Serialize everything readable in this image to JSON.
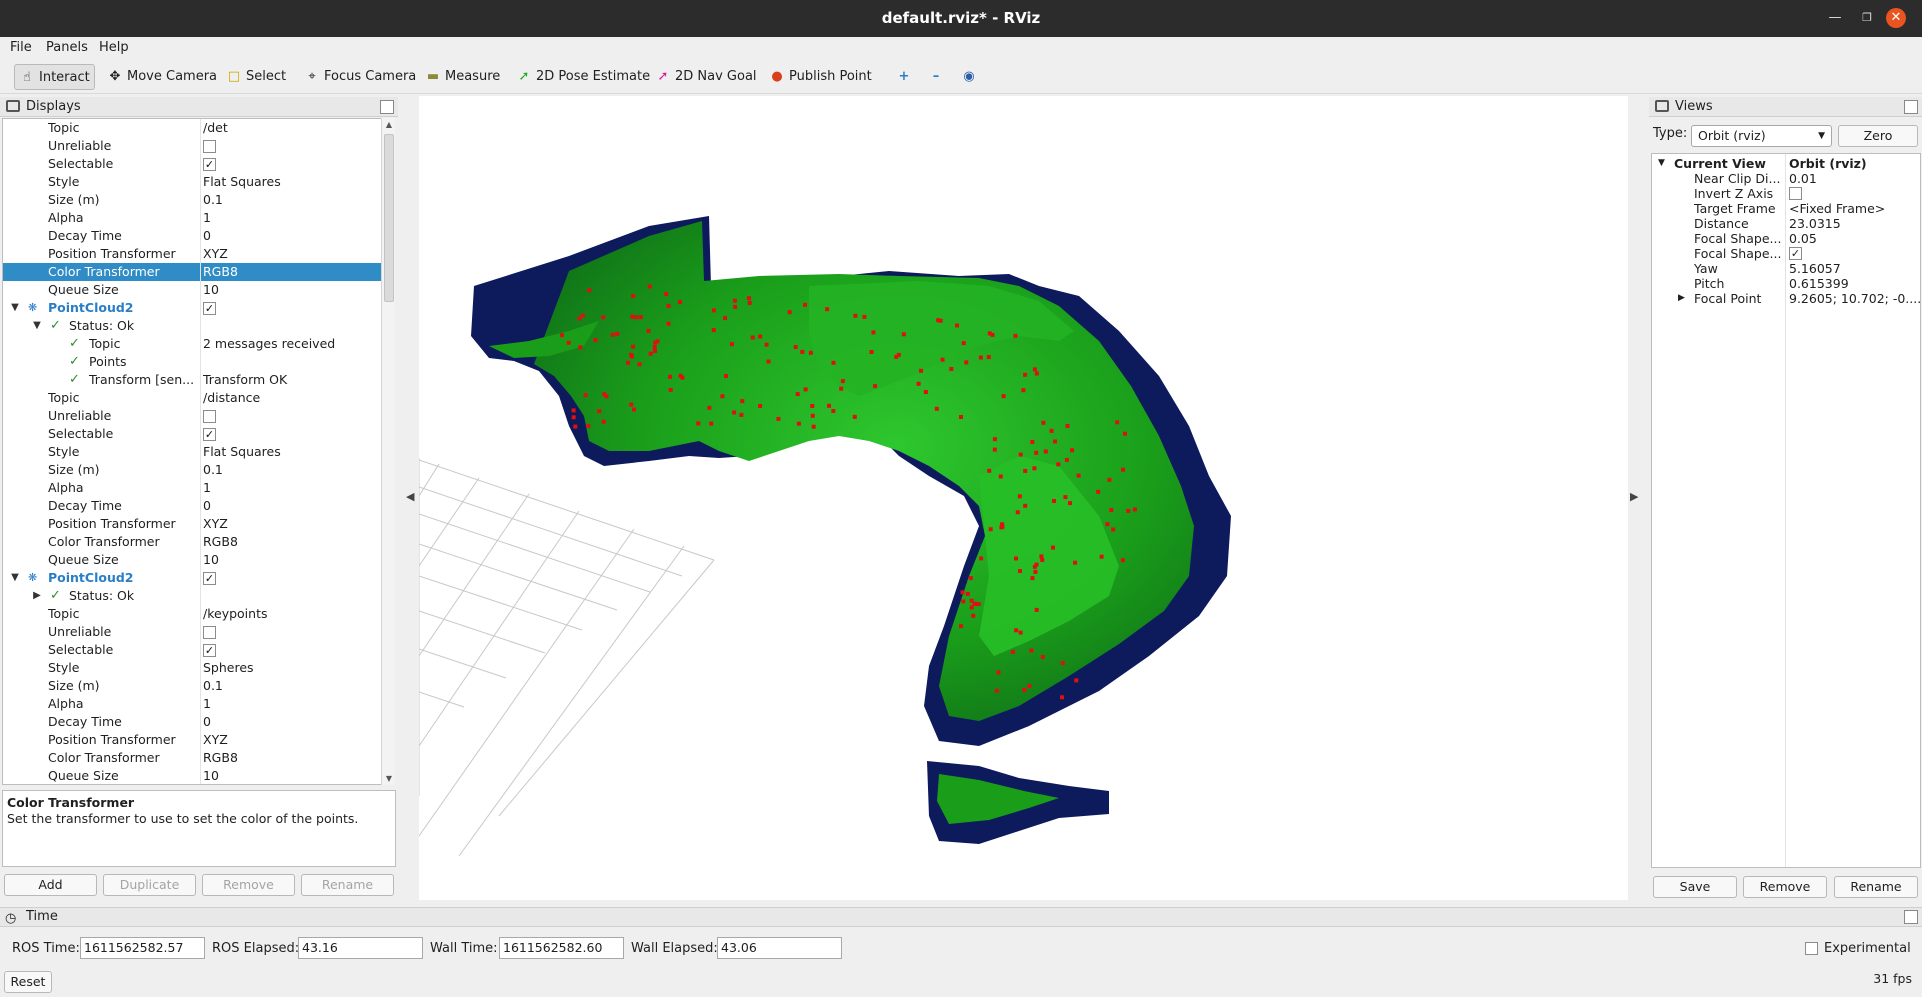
{
  "window": {
    "title": "default.rviz* - RViz"
  },
  "menu": [
    "File",
    "Panels",
    "Help"
  ],
  "toolbar": {
    "interact": "Interact",
    "move_camera": "Move Camera",
    "select": "Select",
    "focus_camera": "Focus Camera",
    "measure": "Measure",
    "pose_estimate": "2D Pose Estimate",
    "nav_goal": "2D Nav Goal",
    "publish_point": "Publish Point"
  },
  "displays": {
    "title": "Displays",
    "rows": [
      {
        "name": "Topic",
        "value": "/det"
      },
      {
        "name": "Unreliable",
        "checked": false
      },
      {
        "name": "Selectable",
        "checked": true
      },
      {
        "name": "Style",
        "value": "Flat Squares"
      },
      {
        "name": "Size (m)",
        "value": "0.1"
      },
      {
        "name": "Alpha",
        "value": "1"
      },
      {
        "name": "Decay Time",
        "value": "0"
      },
      {
        "name": "Position Transformer",
        "value": "XYZ"
      },
      {
        "name": "Color Transformer",
        "value": "RGB8"
      },
      {
        "name": "Queue Size",
        "value": "10"
      },
      {
        "name": "PointCloud2",
        "checked": true
      },
      {
        "name": "Status: Ok"
      },
      {
        "name": "Topic",
        "value": "2 messages received"
      },
      {
        "name": "Points"
      },
      {
        "name": "Transform [sen...",
        "value": "Transform OK"
      },
      {
        "name": "Topic",
        "value": "/distance"
      },
      {
        "name": "Unreliable",
        "checked": false
      },
      {
        "name": "Selectable",
        "checked": true
      },
      {
        "name": "Style",
        "value": "Flat Squares"
      },
      {
        "name": "Size (m)",
        "value": "0.1"
      },
      {
        "name": "Alpha",
        "value": "1"
      },
      {
        "name": "Decay Time",
        "value": "0"
      },
      {
        "name": "Position Transformer",
        "value": "XYZ"
      },
      {
        "name": "Color Transformer",
        "value": "RGB8"
      },
      {
        "name": "Queue Size",
        "value": "10"
      },
      {
        "name": "PointCloud2",
        "checked": true
      },
      {
        "name": "Status: Ok"
      },
      {
        "name": "Topic",
        "value": "/keypoints"
      },
      {
        "name": "Unreliable",
        "checked": false
      },
      {
        "name": "Selectable",
        "checked": true
      },
      {
        "name": "Style",
        "value": "Spheres"
      },
      {
        "name": "Size (m)",
        "value": "0.1"
      },
      {
        "name": "Alpha",
        "value": "1"
      },
      {
        "name": "Decay Time",
        "value": "0"
      },
      {
        "name": "Position Transformer",
        "value": "XYZ"
      },
      {
        "name": "Color Transformer",
        "value": "RGB8"
      },
      {
        "name": "Queue Size",
        "value": "10"
      }
    ],
    "description_title": "Color Transformer",
    "description_text": "Set the transformer to use to set the color of the points.",
    "buttons": {
      "add": "Add",
      "duplicate": "Duplicate",
      "remove": "Remove",
      "rename": "Rename"
    }
  },
  "views": {
    "title": "Views",
    "type_label": "Type:",
    "type_value": "Orbit (rviz)",
    "zero": "Zero",
    "rows": [
      {
        "name": "Current View",
        "value": "Orbit (rviz)"
      },
      {
        "name": "Near Clip Di...",
        "value": "0.01"
      },
      {
        "name": "Invert Z Axis",
        "checked": false
      },
      {
        "name": "Target Frame",
        "value": "<Fixed Frame>"
      },
      {
        "name": "Distance",
        "value": "23.0315"
      },
      {
        "name": "Focal Shape...",
        "value": "0.05"
      },
      {
        "name": "Focal Shape...",
        "checked": true
      },
      {
        "name": "Yaw",
        "value": "5.16057"
      },
      {
        "name": "Pitch",
        "value": "0.615399"
      },
      {
        "name": "Focal Point",
        "value": "9.2605; 10.702; -0...."
      }
    ],
    "buttons": {
      "save": "Save",
      "remove": "Remove",
      "rename": "Rename"
    }
  },
  "time": {
    "title": "Time",
    "ros_time_label": "ROS Time:",
    "ros_time": "1611562582.57",
    "ros_elapsed_label": "ROS Elapsed:",
    "ros_elapsed": "43.16",
    "wall_time_label": "Wall Time:",
    "wall_time": "1611562582.60",
    "wall_elapsed_label": "Wall Elapsed:",
    "wall_elapsed": "43.06",
    "experimental": "Experimental",
    "reset": "Reset",
    "fps": "31 fps"
  },
  "colors": {
    "selection": "#308cc6",
    "cloud_green": "#1e9b1e",
    "cloud_navy": "#0d1a5c",
    "keypoint_red": "#e01010",
    "grid": "#c8c8c8"
  }
}
